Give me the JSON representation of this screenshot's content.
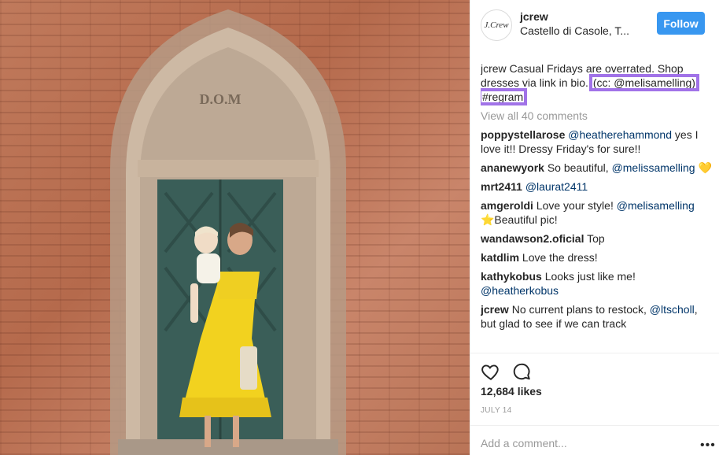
{
  "post": {
    "username": "jcrew",
    "avatar_text": "J.Crew",
    "location": "Castello di Casole, T...",
    "follow_label": "Follow",
    "photo_inscription": "D.O.M",
    "caption_user": "jcrew",
    "caption_text": " Casual Fridays are overrated. Shop dresses via link in bio. ",
    "caption_cc": "(cc: @melisamelling)",
    "caption_tag": "#regram",
    "view_all": "View all 40 comments",
    "likes": "12,684 likes",
    "date": "JULY 14",
    "add_comment_placeholder": "Add a comment...",
    "more_dots": "•••"
  },
  "comments": [
    {
      "user": "poppystellarose",
      "mention": "@heatherehammond",
      "text": " yes I love it!! Dressy Friday's for sure!!"
    },
    {
      "user": "ananewyork",
      "text": " So beautiful, ",
      "mention": "@melissamelling",
      "after": " 💛"
    },
    {
      "user": "mrt2411",
      "mention": "@laurat2411"
    },
    {
      "user": "amgeroldi",
      "text": " Love your style! ",
      "mention": "@melisamelling",
      "after": " ⭐Beautiful pic!"
    },
    {
      "user": "wandawson2.oficial",
      "text": " Top"
    },
    {
      "user": "katdlim",
      "text": " Love the dress!"
    },
    {
      "user": "kathykobus",
      "text": " Looks just like me! ",
      "mention": "@heatherkobus"
    },
    {
      "user": "jcrew",
      "text": " No current plans to restock, ",
      "mention": "@ltscholl",
      "after": ", but glad to see if we can track"
    }
  ],
  "colors": {
    "accent": "#3897f0",
    "highlight": "#a173e8",
    "mention": "#003569"
  }
}
